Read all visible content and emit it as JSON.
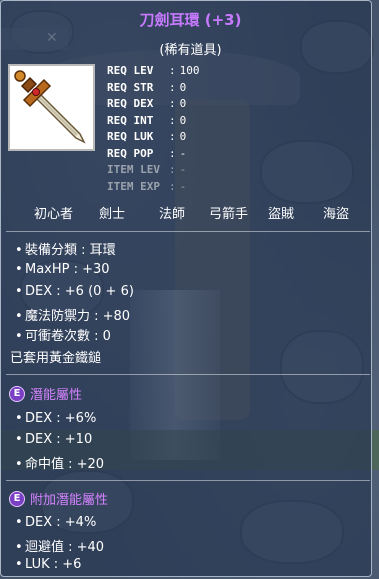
{
  "item": {
    "title": "刀劍耳環 (+3)",
    "rarity": "(稀有道具)"
  },
  "requirements": [
    {
      "key": "REQ LEV",
      "value": "100",
      "dim": false
    },
    {
      "key": "REQ STR",
      "value": "0",
      "dim": false
    },
    {
      "key": "REQ DEX",
      "value": "0",
      "dim": false
    },
    {
      "key": "REQ INT",
      "value": "0",
      "dim": false
    },
    {
      "key": "REQ LUK",
      "value": "0",
      "dim": false
    },
    {
      "key": "REQ POP",
      "value": "-",
      "dim": false
    },
    {
      "key": "ITEM LEV",
      "value": "-",
      "dim": true
    },
    {
      "key": "ITEM EXP",
      "value": "-",
      "dim": true
    }
  ],
  "jobs": [
    "初心者",
    "劍士",
    "法師",
    "弓箭手",
    "盜賊",
    "海盜"
  ],
  "stats": [
    "裝備分類 : 耳環",
    "MaxHP : +30",
    "DEX : +6 (0 + 6)",
    "魔法防禦力 : +80",
    "可衝卷次數 : 0"
  ],
  "golden_hammer": "已套用黃金鐵鎚",
  "potential": {
    "badge": "E",
    "title": "潛能屬性",
    "lines": [
      "DEX : +6%",
      "DEX : +10",
      "命中值 : +20"
    ]
  },
  "bonus_potential": {
    "badge": "E",
    "title": "附加潛能屬性",
    "lines": [
      "DEX : +4%",
      "迴避值 : +40",
      "LUK : +6"
    ]
  }
}
